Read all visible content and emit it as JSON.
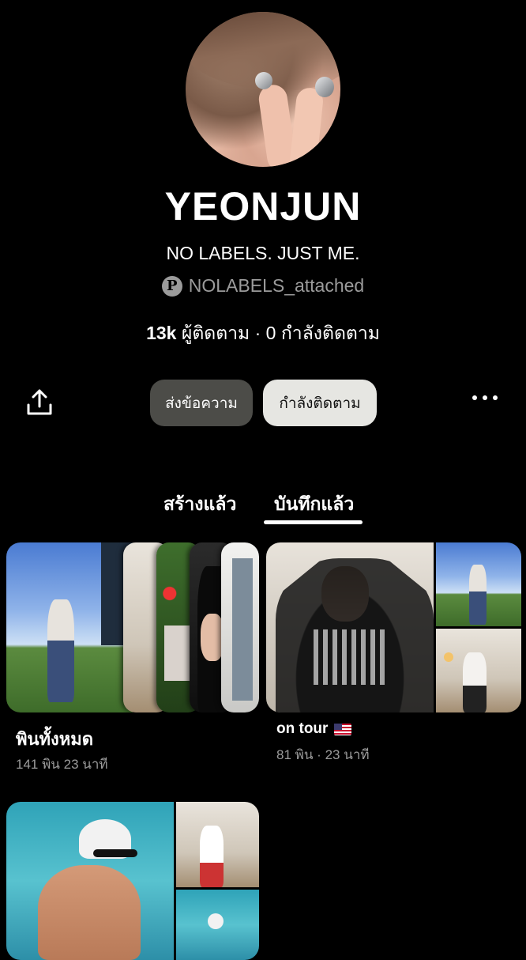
{
  "profile": {
    "name": "YEONJUN",
    "bio": "NO LABELS. JUST ME.",
    "handle": "NOLABELS_attached",
    "followers": "13k",
    "followers_label": "ผู้ติดตาม",
    "separator": "·",
    "following": "0",
    "following_label": "กำลังติดตาม"
  },
  "actions": {
    "message_label": "ส่งข้อความ",
    "following_button_label": "กำลังติดตาม"
  },
  "tabs": {
    "created": "สร้างแล้ว",
    "saved": "บันทึกแล้ว",
    "active": "saved"
  },
  "boards": [
    {
      "title": "พินทั้งหมด",
      "meta": "141 พิน   23 นาที"
    },
    {
      "title": "on tour",
      "meta": "81 พิน · 23 นาที",
      "emoji": "us-flag"
    }
  ],
  "icons": {
    "share": "share-icon",
    "more": "more-options-icon",
    "pinterest": "pinterest-logo-icon"
  }
}
